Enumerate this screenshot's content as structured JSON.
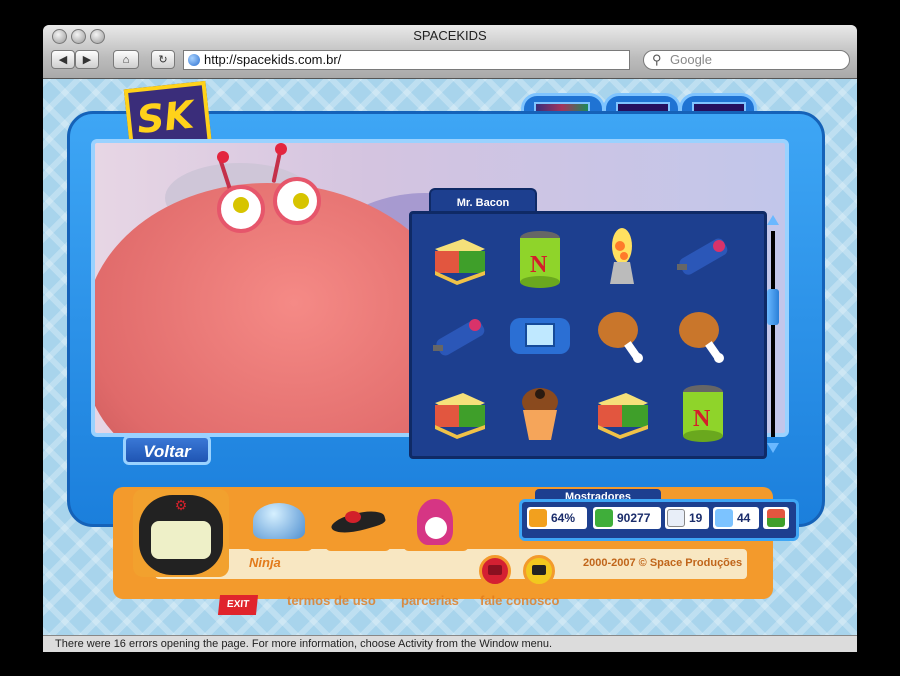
{
  "browser": {
    "window_title": "SPACEKIDS",
    "url": "http://spacekids.com.br/",
    "search_placeholder": "Google",
    "status_text": "There were 16 errors opening the page. For more information, choose Activity from the Window menu."
  },
  "game": {
    "inventory_title": "Mr. Bacon",
    "voltar_label": "Voltar",
    "character_name": "Ninja",
    "copyright": "2000-2007 © Space Produções",
    "mostradores_title": "Mostradores",
    "stats": {
      "energy": "64%",
      "money": "90277",
      "messages": "19",
      "chat": "44"
    },
    "footer_links": [
      "termos de uso",
      "parcerias",
      "fale conosco"
    ],
    "exit_label": "EXIT",
    "help_label": "?",
    "logo_text": "SK",
    "inventory_items": [
      "sandwich-icon",
      "paint-can-icon",
      "lava-lamp-icon",
      "remote-control-icon",
      "remote-control-icon",
      "handheld-console-icon",
      "chicken-leg-icon",
      "chicken-leg-icon",
      "sandwich-icon",
      "cupcake-icon",
      "sandwich-icon",
      "paint-can-icon"
    ],
    "colors": {
      "frame_blue": "#1b7fdc",
      "panel_orange": "#f39a2c",
      "inventory_navy": "#1d3f8f"
    }
  }
}
